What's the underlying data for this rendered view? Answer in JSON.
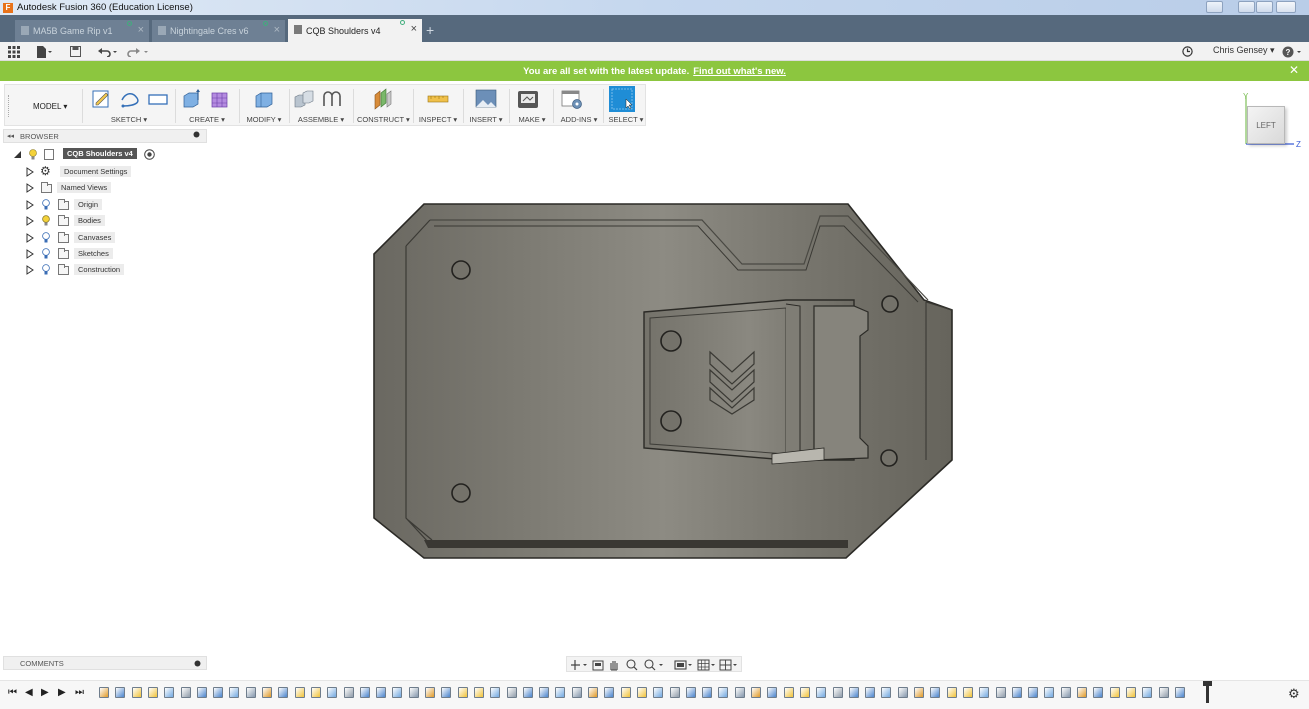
{
  "window": {
    "title": "Autodesk Fusion 360 (Education License)"
  },
  "tabs": [
    {
      "label": "MA5B Game Rip v1",
      "active": false
    },
    {
      "label": "Nightingale Cres v6",
      "active": false
    },
    {
      "label": "CQB Shoulders v4",
      "active": true
    }
  ],
  "quick_access": {
    "user": "Chris Gensey ▾",
    "help": "?"
  },
  "notification": {
    "message": "You are all set with the latest update.",
    "link": "Find out what's new.",
    "color": "#8cc63f"
  },
  "toolbar": {
    "workspace": "MODEL ▾",
    "groups": {
      "sketch": "SKETCH ▾",
      "create": "CREATE ▾",
      "modify": "MODIFY ▾",
      "assemble": "ASSEMBLE ▾",
      "construct": "CONSTRUCT ▾",
      "inspect": "INSPECT ▾",
      "insert": "INSERT ▾",
      "make": "MAKE ▾",
      "addins": "ADD-INS ▾",
      "select": "SELECT ▾"
    },
    "accent": "#1f8dd6"
  },
  "browser": {
    "title": "BROWSER",
    "root": "CQB Shoulders v4",
    "nodes": [
      {
        "label": "Document Settings",
        "icon": "gear-icon"
      },
      {
        "label": "Named Views",
        "icon": "folder-icon"
      },
      {
        "label": "Origin",
        "icon": "folder-icon"
      },
      {
        "label": "Bodies",
        "icon": "folder-icon"
      },
      {
        "label": "Canvases",
        "icon": "folder-icon"
      },
      {
        "label": "Sketches",
        "icon": "folder-icon"
      },
      {
        "label": "Construction",
        "icon": "folder-icon"
      }
    ]
  },
  "comments": {
    "title": "COMMENTS"
  },
  "viewcube": {
    "face": "LEFT",
    "axis_y": "Y",
    "axis_z": "Z"
  }
}
